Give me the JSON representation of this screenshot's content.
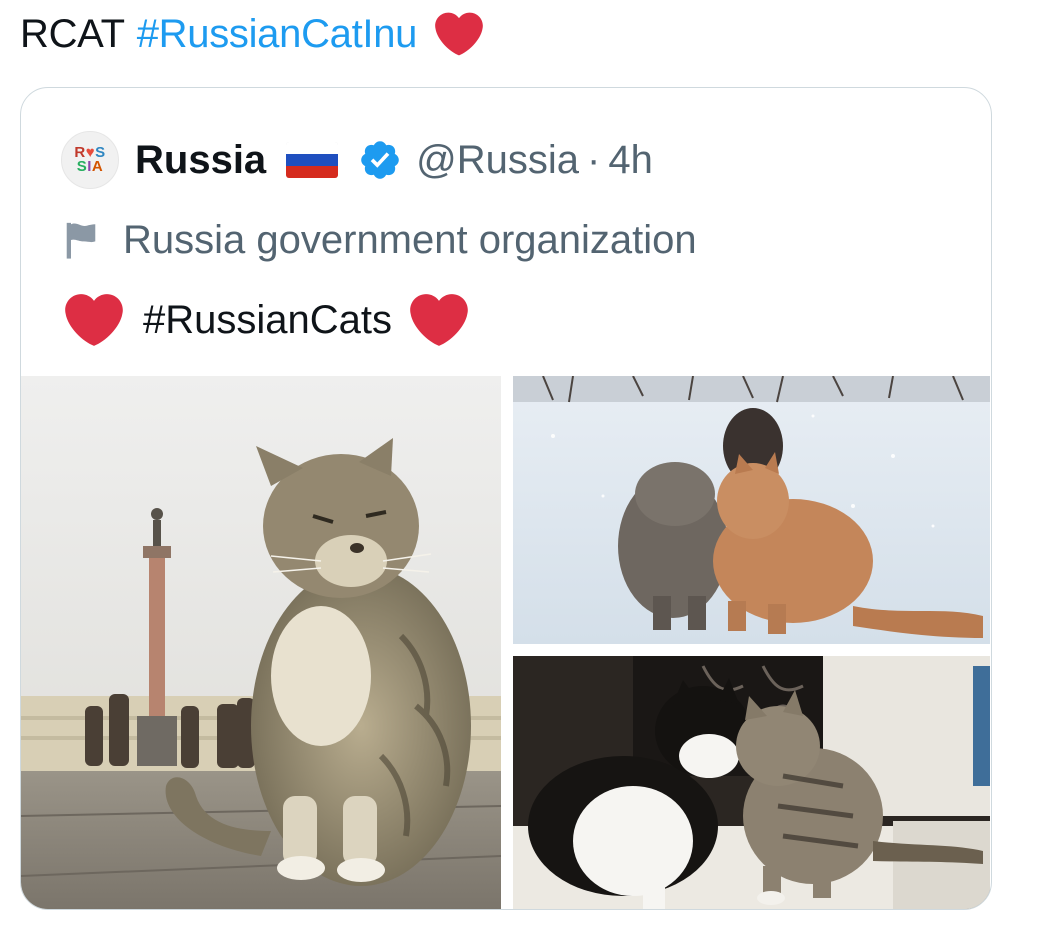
{
  "tweet": {
    "text": "RCAT",
    "hashtag": "#RussianCatInu",
    "trailing_emoji": "heart-emoji"
  },
  "quote": {
    "author": {
      "display_name": "Russia",
      "flag_emoji": "russia-flag",
      "verified": true,
      "handle": "@Russia",
      "separator": "·",
      "time": "4h",
      "avatar_lines": [
        "RUS",
        "SIA"
      ]
    },
    "label": "Russia government organization",
    "text": "#RussianCats",
    "media": [
      {
        "name": "tabby-cat-palace-square-photo"
      },
      {
        "name": "two-fluffy-cats-in-snow-photo"
      },
      {
        "name": "black-white-and-tabby-cats-photo"
      }
    ]
  },
  "colors": {
    "link": "#1d9bf0",
    "text": "#0f1419",
    "secondary": "#536471",
    "border": "#cfd9de",
    "heart": "#dd2e44",
    "verified": "#1d9bf0"
  }
}
